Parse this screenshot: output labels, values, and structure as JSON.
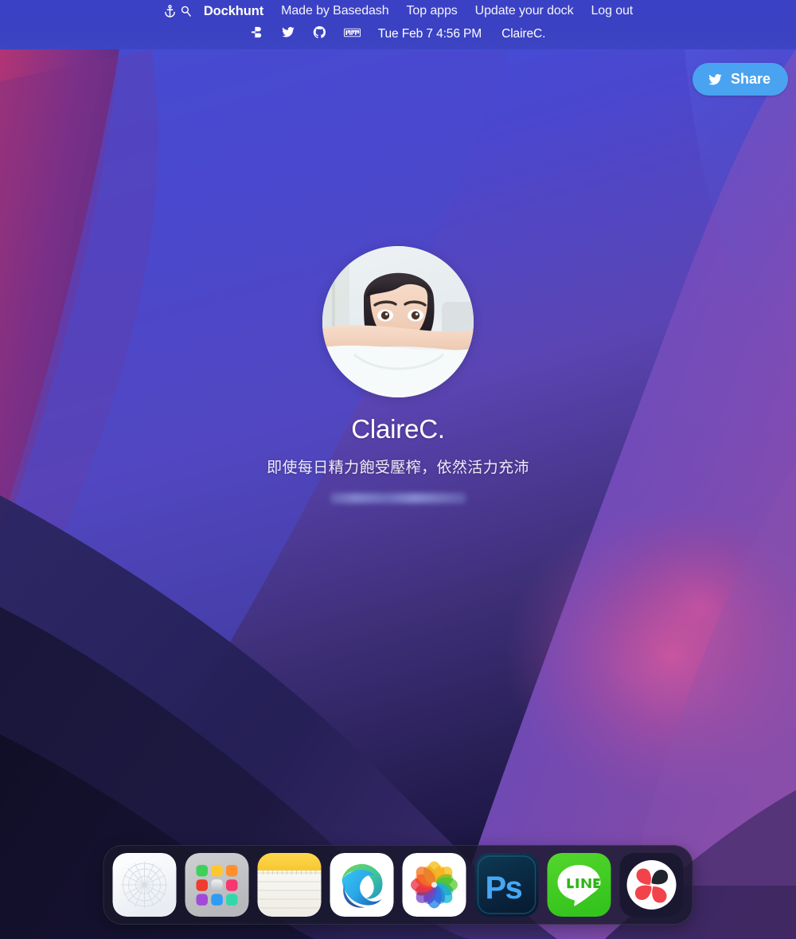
{
  "menubar": {
    "anchor_icon": "anchor-icon",
    "search_icon": "search-icon",
    "brand": "Dockhunt",
    "links": [
      {
        "label": "Made by Basedash"
      },
      {
        "label": "Top apps"
      },
      {
        "label": "Update your dock"
      },
      {
        "label": "Log out"
      }
    ],
    "social": [
      {
        "name": "basedash-icon"
      },
      {
        "name": "twitter-icon"
      },
      {
        "name": "github-icon"
      },
      {
        "name": "npm-icon"
      }
    ],
    "datetime": "Tue Feb 7 4:56 PM",
    "user": "ClaireC."
  },
  "share": {
    "label": "Share",
    "icon": "twitter-icon",
    "color": "#4aa3f0"
  },
  "profile": {
    "avatar_alt": "ClaireC. profile photo",
    "name": "ClaireC.",
    "bio": "即使每日精力飽受壓榨，依然活力充沛",
    "link_redacted": true
  },
  "dock": {
    "items": [
      {
        "name": "safari-blank-icon",
        "label": "Safari"
      },
      {
        "name": "launchpad-icon",
        "label": "Launchpad"
      },
      {
        "name": "notes-icon",
        "label": "Notes"
      },
      {
        "name": "microsoft-edge-icon",
        "label": "Microsoft Edge"
      },
      {
        "name": "photos-icon",
        "label": "Photos"
      },
      {
        "name": "photoshop-icon",
        "label": "Adobe Photoshop"
      },
      {
        "name": "line-icon",
        "label": "LINE"
      },
      {
        "name": "pixelmator-icon",
        "label": "Pixelmator Pro"
      }
    ]
  },
  "wallpaper": {
    "name": "macos-monterey",
    "colors": {
      "top_blue": "#3d4fd6",
      "mid_purple": "#6a4bb0",
      "magenta": "#b43f83",
      "deep_navy": "#171535",
      "pink_glow": "#c1529b"
    }
  }
}
